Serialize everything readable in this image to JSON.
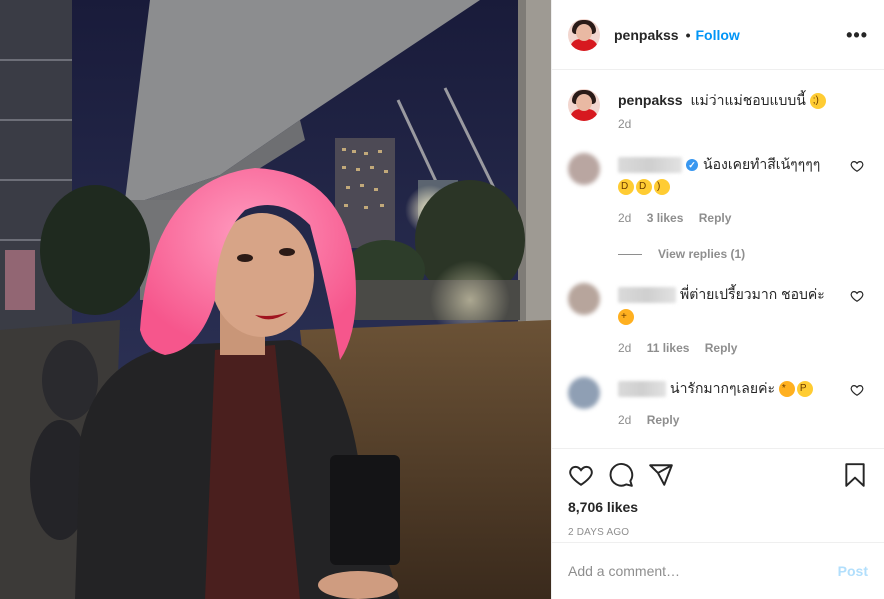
{
  "post": {
    "username": "penpakss",
    "follow_label": "Follow",
    "separator": "•",
    "more_label": "•••"
  },
  "caption": {
    "username": "penpakss",
    "text": "แม่ว่าแม่ชอบแบบนี้",
    "emoji_icon": "winking-face-emoji",
    "time": "2d"
  },
  "comments": [
    {
      "text": "น้องเคยทำสีเน้ๆๆๆๆ",
      "verified": true,
      "emojis": [
        "grinning-squinting-emoji",
        "rolling-laughing-emoji",
        "smiling-eyes-emoji"
      ],
      "time": "2d",
      "likes": "3 likes",
      "reply": "Reply",
      "avatar_color": "#b9a6a1"
    },
    {
      "text": "พี่ต่ายเปรี้ยวมาก ชอบค่ะ",
      "verified": false,
      "emojis": [
        "thumbs-up-emoji"
      ],
      "time": "2d",
      "likes": "11 likes",
      "reply": "Reply",
      "avatar_color": "#b7a59c"
    },
    {
      "text": "น่ารักมากๆเลยค่ะ",
      "verified": false,
      "emojis": [
        "kissing-heart-emoji",
        "winking-tongue-emoji"
      ],
      "time": "2d",
      "likes": "",
      "reply": "Reply",
      "avatar_color": "#8f9fb4"
    }
  ],
  "view_replies": "View replies (1)",
  "actions": {
    "icons": [
      "heart-icon",
      "comment-icon",
      "share-icon",
      "bookmark-icon"
    ],
    "likes": "8,706 likes",
    "date": "2 DAYS AGO"
  },
  "add_comment": {
    "placeholder": "Add a comment…",
    "post_label": "Post"
  },
  "colors": {
    "link": "#0095f6",
    "muted": "#8e8e8e",
    "post_disabled": "#b2dffc",
    "hair": "#ff6f9a"
  }
}
